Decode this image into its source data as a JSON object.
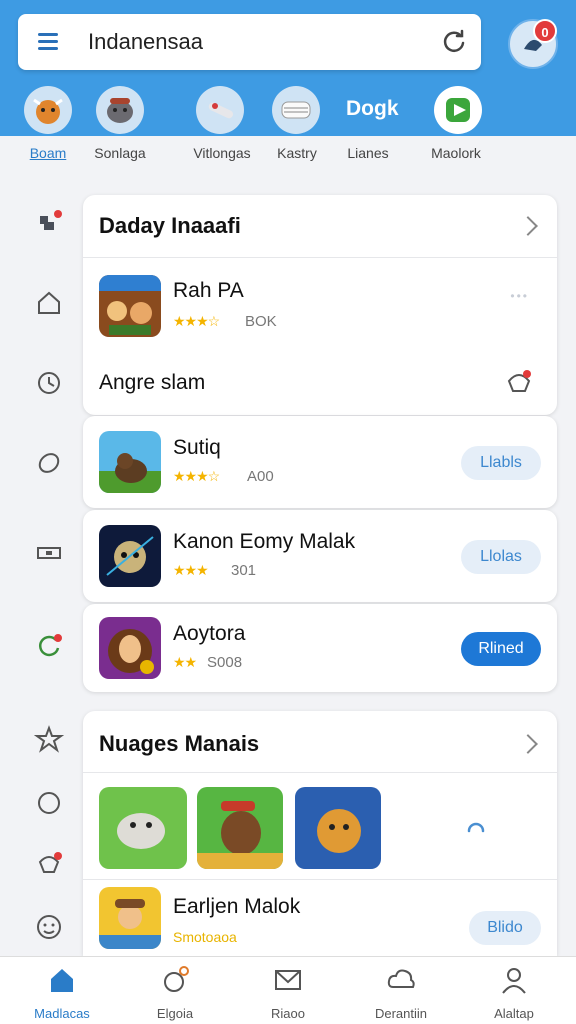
{
  "search": {
    "text": "Indanensaa",
    "notification_count": "0"
  },
  "categories": [
    {
      "label": "Boam",
      "icon": "cow-icon",
      "active": true
    },
    {
      "label": "Sonlaga",
      "icon": "beaver-icon",
      "active": false
    },
    {
      "label": "Vitlongas",
      "icon": "plane-icon",
      "active": false
    },
    {
      "label": "Kastry",
      "icon": "sushi-icon",
      "active": false
    },
    {
      "label": "Lianes",
      "icon": "text-icon",
      "text": "Dogk",
      "active": false
    },
    {
      "label": "Maolork",
      "icon": "play-icon",
      "active": false
    }
  ],
  "section1": {
    "title": "Daday Inaaafi",
    "apps": [
      {
        "name": "Rah PA",
        "stars": "★★★☆",
        "rating": "BOK"
      },
      {
        "name": "Sutiq",
        "stars": "★★★☆",
        "rating": "A00",
        "action": "Llabls"
      },
      {
        "name": "Kanon Eomy Malak",
        "stars": "★★★",
        "rating": "301",
        "action": "Llolas"
      },
      {
        "name": "Aoytora",
        "stars": "★★",
        "rating": "S008",
        "action": "Rlined"
      }
    ],
    "subheading": "Angre slam"
  },
  "section2": {
    "title": "Nuages Manais",
    "last_app": {
      "name": "Earljen Malok",
      "subtitle": "Smotoaoa",
      "action": "Blido"
    }
  },
  "bottom_nav": [
    {
      "label": "Madlacas",
      "icon": "home-icon",
      "active": true
    },
    {
      "label": "Elgoia",
      "icon": "games-icon",
      "active": false
    },
    {
      "label": "Riaoo",
      "icon": "mail-icon",
      "active": false
    },
    {
      "label": "Derantiin",
      "icon": "cloud-icon",
      "active": false
    },
    {
      "label": "Alaltap",
      "icon": "profile-icon",
      "active": false
    }
  ],
  "colors": {
    "accent": "#3e9be3",
    "primary_button": "#1e78d6",
    "star": "#f4b400"
  }
}
